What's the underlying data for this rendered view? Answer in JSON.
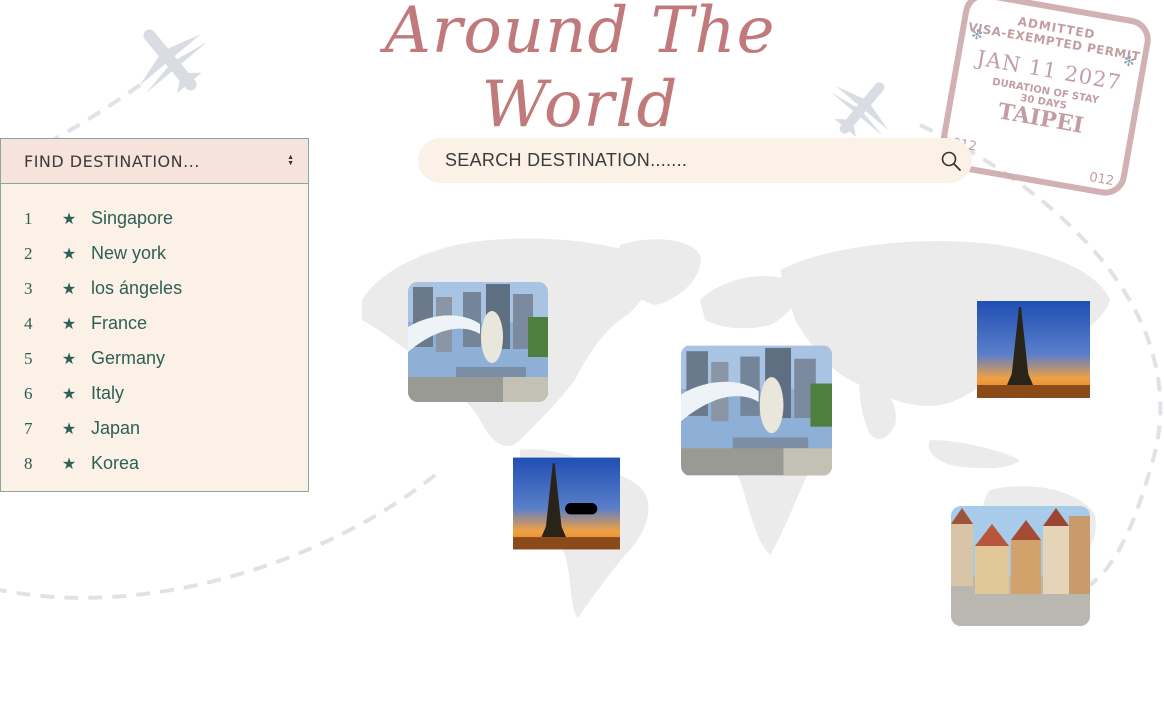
{
  "header": {
    "title": "Around The World"
  },
  "stamp": {
    "admitted": "ADMITTED",
    "visa": "VISA-EXEMPTED PERMIT",
    "date": "JAN 11 2027",
    "duration": "DURATION OF STAY",
    "days": "30 DAYS",
    "city": "TAIPEI",
    "code_left": "012",
    "code_right": "012"
  },
  "sidebar": {
    "header_label": "FIND DESTINATION...",
    "items": [
      {
        "num": "1",
        "name": "Singapore"
      },
      {
        "num": "2",
        "name": "New york"
      },
      {
        "num": "3",
        "name": "los ángeles"
      },
      {
        "num": "4",
        "name": "France"
      },
      {
        "num": "5",
        "name": "Germany"
      },
      {
        "num": "6",
        "name": "Italy"
      },
      {
        "num": "7",
        "name": "Japan"
      },
      {
        "num": "8",
        "name": "Korea"
      }
    ],
    "star_glyph": "★"
  },
  "search": {
    "placeholder": "SEARCH DESTINATION......."
  },
  "colors": {
    "title": "#c07a7b",
    "accent_green": "#2f5f57",
    "panel_bg": "#fbf1e6",
    "header_bg": "#f6e3dc"
  },
  "icons": [
    "airplane-icon",
    "search-icon",
    "sort-arrows-icon",
    "star-icon"
  ]
}
